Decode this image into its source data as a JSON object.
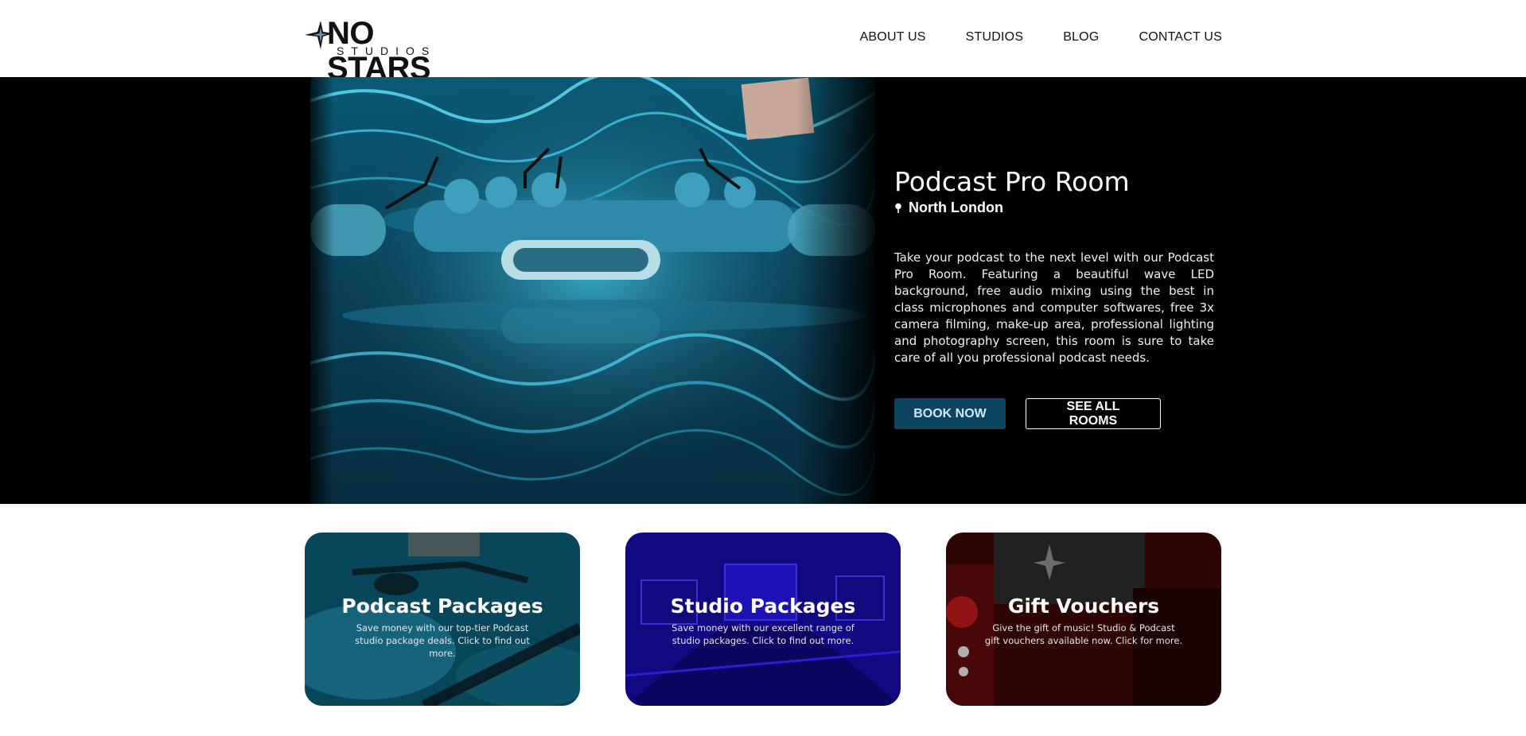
{
  "header": {
    "logo": {
      "main": "NO STARS",
      "sub": "STUDIOS"
    },
    "nav": [
      {
        "label": "ABOUT US"
      },
      {
        "label": "STUDIOS"
      },
      {
        "label": "BLOG"
      },
      {
        "label": "CONTACT US"
      }
    ]
  },
  "hero": {
    "title": "Podcast Pro Room",
    "location": "North London",
    "description": "Take your podcast to the next level with our Podcast Pro Room. Featuring a beautiful wave LED background, free audio mixing using the best in class microphones and computer softwares, free 3x camera filming, make-up area, professional lighting and photography screen, this room is sure to take care of all you professional podcast needs.",
    "book_label": "BOOK NOW",
    "rooms_label": "SEE ALL ROOMS"
  },
  "cards": [
    {
      "title": "Podcast Packages",
      "desc": "Save money with our top-tier Podcast studio package deals. Click to find out more."
    },
    {
      "title": "Studio Packages",
      "desc": "Save money with our excellent range of studio packages. Click to find out more."
    },
    {
      "title": "Gift Vouchers",
      "desc": "Give the gift of music! Studio & Podcast gift vouchers available now. Click for more."
    }
  ],
  "colors": {
    "accent_button": "#0d4561",
    "hero_background": "#000000",
    "podcast_card_tint": "#0b5f7a",
    "studio_card_tint": "#1a0aa8",
    "voucher_card_tint": "#5a0a0a"
  },
  "icons": {
    "logo_star": "star-icon",
    "location": "map-pin-icon"
  }
}
